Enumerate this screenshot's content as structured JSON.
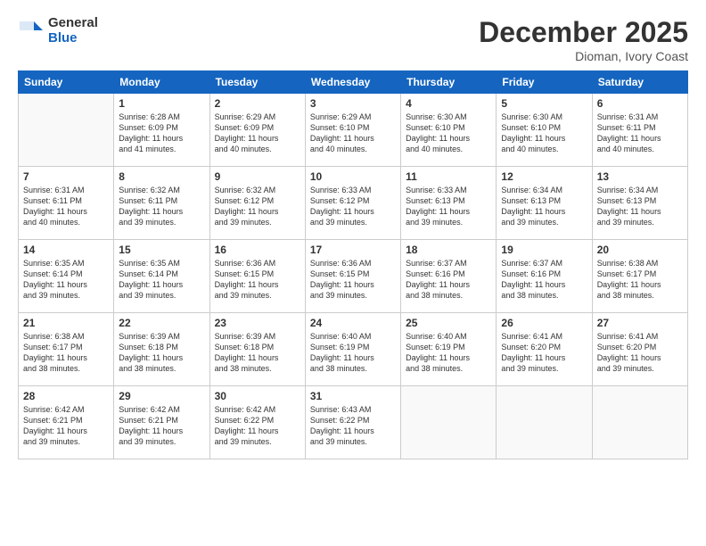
{
  "logo": {
    "general": "General",
    "blue": "Blue"
  },
  "header": {
    "month": "December 2025",
    "location": "Dioman, Ivory Coast"
  },
  "weekdays": [
    "Sunday",
    "Monday",
    "Tuesday",
    "Wednesday",
    "Thursday",
    "Friday",
    "Saturday"
  ],
  "weeks": [
    [
      {
        "day": "",
        "info": ""
      },
      {
        "day": "1",
        "info": "Sunrise: 6:28 AM\nSunset: 6:09 PM\nDaylight: 11 hours\nand 41 minutes."
      },
      {
        "day": "2",
        "info": "Sunrise: 6:29 AM\nSunset: 6:09 PM\nDaylight: 11 hours\nand 40 minutes."
      },
      {
        "day": "3",
        "info": "Sunrise: 6:29 AM\nSunset: 6:10 PM\nDaylight: 11 hours\nand 40 minutes."
      },
      {
        "day": "4",
        "info": "Sunrise: 6:30 AM\nSunset: 6:10 PM\nDaylight: 11 hours\nand 40 minutes."
      },
      {
        "day": "5",
        "info": "Sunrise: 6:30 AM\nSunset: 6:10 PM\nDaylight: 11 hours\nand 40 minutes."
      },
      {
        "day": "6",
        "info": "Sunrise: 6:31 AM\nSunset: 6:11 PM\nDaylight: 11 hours\nand 40 minutes."
      }
    ],
    [
      {
        "day": "7",
        "info": "Sunrise: 6:31 AM\nSunset: 6:11 PM\nDaylight: 11 hours\nand 40 minutes."
      },
      {
        "day": "8",
        "info": "Sunrise: 6:32 AM\nSunset: 6:11 PM\nDaylight: 11 hours\nand 39 minutes."
      },
      {
        "day": "9",
        "info": "Sunrise: 6:32 AM\nSunset: 6:12 PM\nDaylight: 11 hours\nand 39 minutes."
      },
      {
        "day": "10",
        "info": "Sunrise: 6:33 AM\nSunset: 6:12 PM\nDaylight: 11 hours\nand 39 minutes."
      },
      {
        "day": "11",
        "info": "Sunrise: 6:33 AM\nSunset: 6:13 PM\nDaylight: 11 hours\nand 39 minutes."
      },
      {
        "day": "12",
        "info": "Sunrise: 6:34 AM\nSunset: 6:13 PM\nDaylight: 11 hours\nand 39 minutes."
      },
      {
        "day": "13",
        "info": "Sunrise: 6:34 AM\nSunset: 6:13 PM\nDaylight: 11 hours\nand 39 minutes."
      }
    ],
    [
      {
        "day": "14",
        "info": "Sunrise: 6:35 AM\nSunset: 6:14 PM\nDaylight: 11 hours\nand 39 minutes."
      },
      {
        "day": "15",
        "info": "Sunrise: 6:35 AM\nSunset: 6:14 PM\nDaylight: 11 hours\nand 39 minutes."
      },
      {
        "day": "16",
        "info": "Sunrise: 6:36 AM\nSunset: 6:15 PM\nDaylight: 11 hours\nand 39 minutes."
      },
      {
        "day": "17",
        "info": "Sunrise: 6:36 AM\nSunset: 6:15 PM\nDaylight: 11 hours\nand 39 minutes."
      },
      {
        "day": "18",
        "info": "Sunrise: 6:37 AM\nSunset: 6:16 PM\nDaylight: 11 hours\nand 38 minutes."
      },
      {
        "day": "19",
        "info": "Sunrise: 6:37 AM\nSunset: 6:16 PM\nDaylight: 11 hours\nand 38 minutes."
      },
      {
        "day": "20",
        "info": "Sunrise: 6:38 AM\nSunset: 6:17 PM\nDaylight: 11 hours\nand 38 minutes."
      }
    ],
    [
      {
        "day": "21",
        "info": "Sunrise: 6:38 AM\nSunset: 6:17 PM\nDaylight: 11 hours\nand 38 minutes."
      },
      {
        "day": "22",
        "info": "Sunrise: 6:39 AM\nSunset: 6:18 PM\nDaylight: 11 hours\nand 38 minutes."
      },
      {
        "day": "23",
        "info": "Sunrise: 6:39 AM\nSunset: 6:18 PM\nDaylight: 11 hours\nand 38 minutes."
      },
      {
        "day": "24",
        "info": "Sunrise: 6:40 AM\nSunset: 6:19 PM\nDaylight: 11 hours\nand 38 minutes."
      },
      {
        "day": "25",
        "info": "Sunrise: 6:40 AM\nSunset: 6:19 PM\nDaylight: 11 hours\nand 38 minutes."
      },
      {
        "day": "26",
        "info": "Sunrise: 6:41 AM\nSunset: 6:20 PM\nDaylight: 11 hours\nand 39 minutes."
      },
      {
        "day": "27",
        "info": "Sunrise: 6:41 AM\nSunset: 6:20 PM\nDaylight: 11 hours\nand 39 minutes."
      }
    ],
    [
      {
        "day": "28",
        "info": "Sunrise: 6:42 AM\nSunset: 6:21 PM\nDaylight: 11 hours\nand 39 minutes."
      },
      {
        "day": "29",
        "info": "Sunrise: 6:42 AM\nSunset: 6:21 PM\nDaylight: 11 hours\nand 39 minutes."
      },
      {
        "day": "30",
        "info": "Sunrise: 6:42 AM\nSunset: 6:22 PM\nDaylight: 11 hours\nand 39 minutes."
      },
      {
        "day": "31",
        "info": "Sunrise: 6:43 AM\nSunset: 6:22 PM\nDaylight: 11 hours\nand 39 minutes."
      },
      {
        "day": "",
        "info": ""
      },
      {
        "day": "",
        "info": ""
      },
      {
        "day": "",
        "info": ""
      }
    ]
  ]
}
